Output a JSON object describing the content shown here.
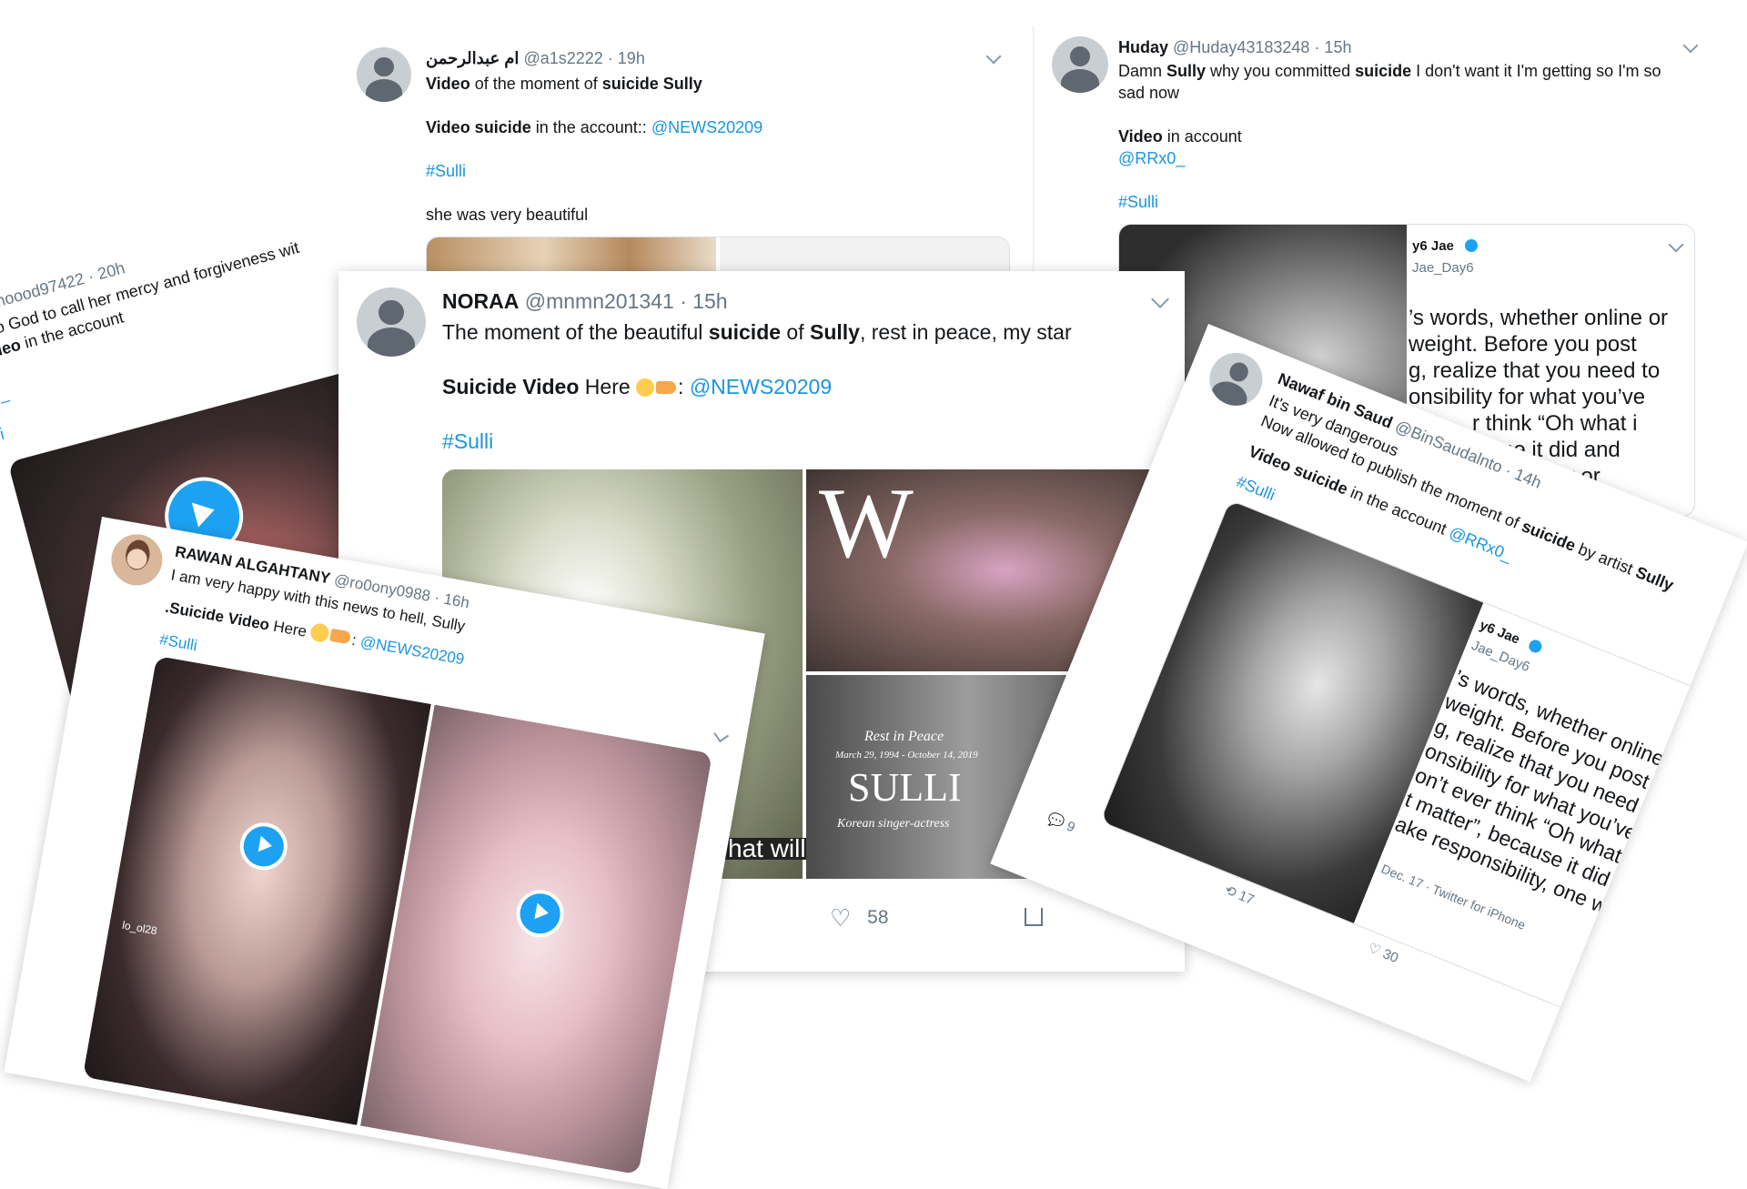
{
  "tweet_arabic": {
    "name": "ام عبدالرحمن",
    "handle": "@a1s2222",
    "time": "· 19h",
    "l1_b1": "Video",
    "l1_t1": " of the moment of ",
    "l1_b2": "suicide Sully",
    "l2_b1": "Video suicide",
    "l2_t1": " in the account:: ",
    "l2_link": "@NEWS20209",
    "hashtag": "#Sulli",
    "l4": "she was very beautiful"
  },
  "tweet_huday": {
    "name": "Huday",
    "handle": "@Huday43183248",
    "time": "· 15h",
    "l1_t1": "Damn ",
    "l1_b1": "Sully",
    "l1_t2": " why you committed ",
    "l1_b2": "suicide",
    "l1_t3": " I don't want it I'm getting so I'm so",
    "l1b": "sad now",
    "l2_b1": "Video",
    "l2_t1": " in account",
    "l3_link": "@RRx0_",
    "hashtag": "#Sulli",
    "quote_name": "y6 Jae",
    "quote_handle": "Jae_Day6",
    "quote_lines": [
      "’s words, whether online or",
      " weight. Before you post",
      "g, realize that you need to",
      "onsibility for what you’ve",
      "r think “Oh what i",
      "use it did and",
      "way or"
    ]
  },
  "tweet_left": {
    "handle": "@hmoood97422 · 20h",
    "l1": "nt to God to call her mercy and forgiveness wit",
    "l2_b": "video",
    "l2_t": " in the account",
    "l3": "0_",
    "l4": "i"
  },
  "tweet_noraa": {
    "name": "NORAA",
    "handle": "@mnmn201341",
    "time": "· 15h",
    "l1_t1": "The moment of the beautiful ",
    "l1_b1": "suicide",
    "l1_t2": " of ",
    "l1_b2": "Sully",
    "l1_t3": ", rest in peace, my star",
    "l2_b1": "Suicide Video",
    "l2_t1": " Here ",
    "l2_colon": ": ",
    "l2_link": "@NEWS20209",
    "hashtag": "#Sulli",
    "caption_snippet": "hat will",
    "magazine_letter": "W",
    "rip_line": "Rest in Peace",
    "rip_dates": "March 29, 1994 - October 14, 2019",
    "rip_name": "SULLI",
    "rip_role": "Korean singer-actress",
    "likes": "58"
  },
  "tweet_rawan": {
    "name": "RAWAN ALGAHTANY",
    "handle": "@ro0ony0988",
    "time": "· 16h",
    "l1": "I am very happy with this news to hell, Sully",
    "l2_b1": ".Suicide Video",
    "l2_t1": " Here ",
    "l2_colon": ": ",
    "l2_link": "@NEWS20209",
    "hashtag": "#Sulli",
    "video_tag": "lo_ol28"
  },
  "tweet_nawaf": {
    "name": "Nawaf bin Saud",
    "handle": "@BinSaudalnto",
    "time": "· 14h",
    "l1": "It's very dangerous",
    "l2_t1": "Now allowed to publish the moment of ",
    "l2_b1": "suicide",
    "l2_t2": " by artist ",
    "l2_b2": "Sully",
    "l3_b1": "Video suicide",
    "l3_t1": " in the account ",
    "l3_link": "@RRx0_",
    "hashtag": "#Sulli",
    "quote_name": "y6 Jae",
    "quote_handle": "Jae_Day6",
    "quote_lines": [
      "’s words, whether online or",
      "weight. Before you post",
      "g, realize that you need to",
      "onsibility for what you’ve",
      "on’t ever think “Oh what i",
      "t matter”, because it did and",
      "ake responsibility, one way or"
    ],
    "quote_date": "Dec. 17 · Twitter for iPhone",
    "replies": "9",
    "retweets": "17",
    "likes": "30"
  },
  "colors": {
    "link": "#1b95e0",
    "muted": "#657786",
    "play": "#1da1f2"
  },
  "icons": [
    "chevron-down-icon",
    "play-icon",
    "heart-icon",
    "share-icon",
    "reply-icon",
    "retweet-icon",
    "verified-icon",
    "sob-emoji",
    "pointing-hand-emoji"
  ]
}
